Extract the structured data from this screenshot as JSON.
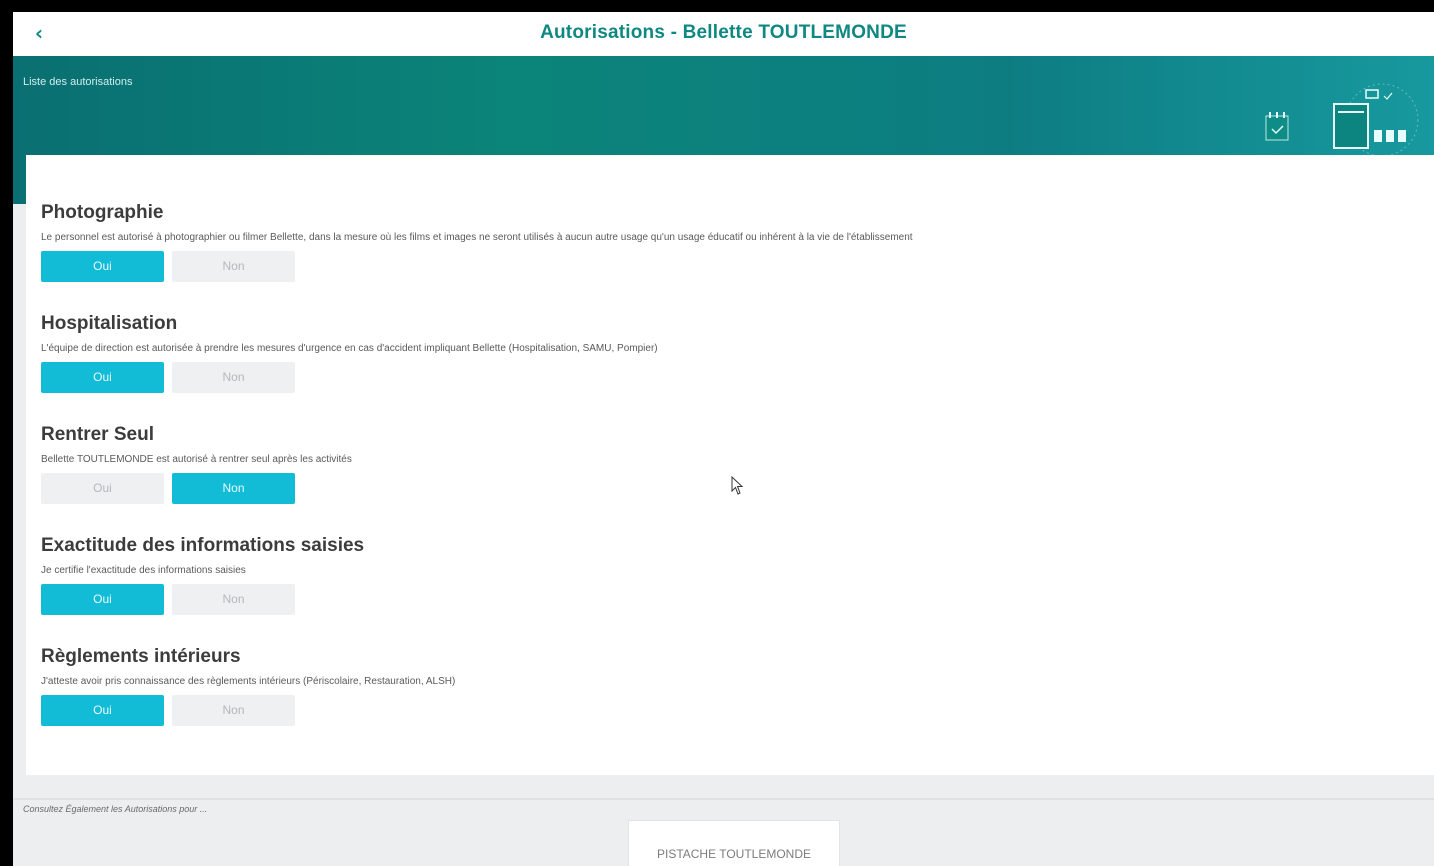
{
  "header": {
    "back_icon": "chevron-left-icon",
    "title": "Autorisations  -  Bellette TOUTLEMONDE"
  },
  "banner": {
    "label": "Liste des autorisations",
    "illustration_icon": "documents-checklist-illustration"
  },
  "sections": [
    {
      "title": "Photographie",
      "description": "Le personnel est autorisé à photographier ou filmer Bellette, dans la mesure où les films et images ne seront utilisés à aucun autre usage qu'un usage éducatif ou inhérent à la vie de l'établissement",
      "yes_label": "Oui",
      "no_label": "Non",
      "selected": "Oui"
    },
    {
      "title": "Hospitalisation",
      "description": "L'équipe de direction est autorisée à prendre les mesures d'urgence en cas d'accident impliquant Bellette (Hospitalisation, SAMU, Pompier)",
      "yes_label": "Oui",
      "no_label": "Non",
      "selected": "Oui"
    },
    {
      "title": "Rentrer Seul",
      "description": "Bellette TOUTLEMONDE est autorisé à rentrer seul après les activités",
      "yes_label": "Oui",
      "no_label": "Non",
      "selected": "Non"
    },
    {
      "title": "Exactitude des informations saisies",
      "description": "Je certifie l'exactitude des informations saisies",
      "yes_label": "Oui",
      "no_label": "Non",
      "selected": "Oui"
    },
    {
      "title": "Règlements intérieurs",
      "description": "J'atteste avoir pris connaissance des règlements intérieurs (Périscolaire, Restauration, ALSH)",
      "yes_label": "Oui",
      "no_label": "Non",
      "selected": "Oui"
    }
  ],
  "footer": {
    "label": "Consultez Également les Autorisations pour ...",
    "child_button": "PISTACHE TOUTLEMONDE"
  },
  "colors": {
    "accent": "#12bcd6",
    "title": "#0f8783",
    "banner": "#0b8479"
  }
}
